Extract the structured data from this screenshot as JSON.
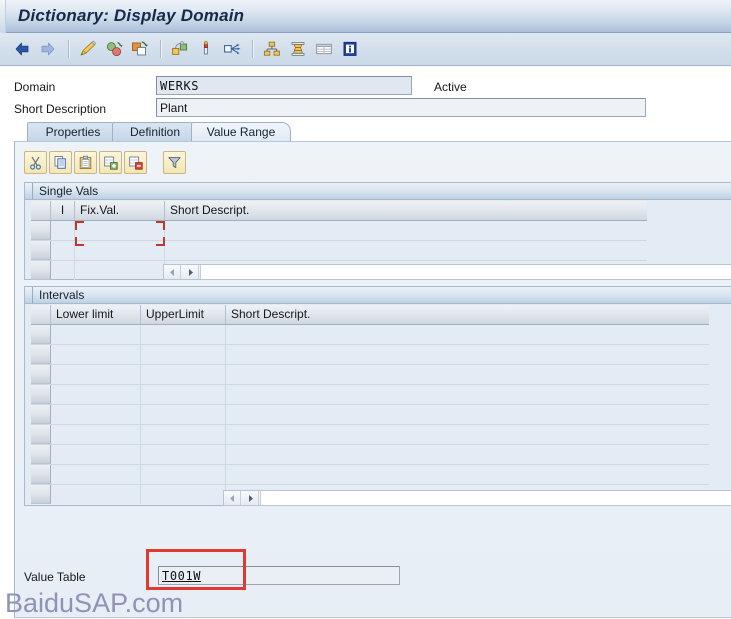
{
  "window": {
    "title": "Dictionary: Display Domain"
  },
  "toolbar": {
    "items": [
      {
        "name": "back-icon",
        "label": "Back"
      },
      {
        "name": "forward-icon",
        "label": "Forward"
      },
      {
        "name": "separator-1",
        "label": ""
      },
      {
        "name": "display-change-icon",
        "label": "Display <-> Change"
      },
      {
        "name": "check-icon",
        "label": "Check"
      },
      {
        "name": "activate-icon",
        "label": "Activate"
      },
      {
        "name": "separator-2",
        "label": ""
      },
      {
        "name": "where-used-icon",
        "label": "Where-Used List"
      },
      {
        "name": "value-range-icon",
        "label": "Value Range"
      },
      {
        "name": "navigate-icon",
        "label": "Navigate"
      },
      {
        "name": "separator-3",
        "label": ""
      },
      {
        "name": "hierarchy-icon",
        "label": "Hierarchy"
      },
      {
        "name": "stack-icon",
        "label": "Stack"
      },
      {
        "name": "table-icon",
        "label": "Table Contents"
      },
      {
        "name": "info-icon",
        "label": "Information"
      }
    ]
  },
  "form": {
    "domain_label": "Domain",
    "domain_value": "WERKS",
    "status": "Active",
    "short_description_label": "Short Description",
    "short_description_value": "Plant"
  },
  "tabs": [
    {
      "label": "Properties",
      "active": false
    },
    {
      "label": "Definition",
      "active": false
    },
    {
      "label": "Value Range",
      "active": true
    }
  ],
  "grid_toolbar": {
    "items": [
      {
        "name": "cut-icon",
        "label": "Cut"
      },
      {
        "name": "copy-icon",
        "label": "Copy"
      },
      {
        "name": "paste-icon",
        "label": "Paste"
      },
      {
        "name": "insert-row-icon",
        "label": "Insert Row"
      },
      {
        "name": "delete-row-icon",
        "label": "Delete Row"
      },
      {
        "name": "filter-icon",
        "label": "Filter"
      }
    ]
  },
  "single_vals": {
    "title": "Single Vals",
    "columns": [
      "",
      "I",
      "Fix.Val.",
      "Short Descript."
    ],
    "rows": [
      {
        "i": "",
        "fix_val": "",
        "short_descript": ""
      },
      {
        "i": "",
        "fix_val": "",
        "short_descript": ""
      },
      {
        "i": "",
        "fix_val": "",
        "short_descript": ""
      }
    ],
    "scroll": {
      "left_arrow": "◄",
      "right_arrow": "►"
    }
  },
  "intervals": {
    "title": "Intervals",
    "columns": [
      "",
      "Lower limit",
      "UpperLimit",
      "Short Descript."
    ],
    "rows": [
      {
        "lower_limit": "",
        "upper_limit": "",
        "short_descript": ""
      },
      {
        "lower_limit": "",
        "upper_limit": "",
        "short_descript": ""
      },
      {
        "lower_limit": "",
        "upper_limit": "",
        "short_descript": ""
      },
      {
        "lower_limit": "",
        "upper_limit": "",
        "short_descript": ""
      },
      {
        "lower_limit": "",
        "upper_limit": "",
        "short_descript": ""
      },
      {
        "lower_limit": "",
        "upper_limit": "",
        "short_descript": ""
      },
      {
        "lower_limit": "",
        "upper_limit": "",
        "short_descript": ""
      },
      {
        "lower_limit": "",
        "upper_limit": "",
        "short_descript": ""
      },
      {
        "lower_limit": "",
        "upper_limit": "",
        "short_descript": ""
      }
    ],
    "scroll": {
      "left_arrow": "◄",
      "right_arrow": "►"
    }
  },
  "value_table": {
    "label": "Value Table",
    "value": "T001W"
  },
  "watermark": "BaiduSAP.com",
  "colors": {
    "title_text": "#162a47",
    "titlebar_top": "#eef3f9",
    "titlebar_bottom": "#a9bfd8",
    "toolbar_bg": "#d2deeb",
    "panel_bg": "#e7eef5",
    "section_header": "#d8e4f0",
    "grid_header": "#e3e8ee",
    "annotation_red": "#e03a2f",
    "cell_cursor_red": "#c0392b",
    "watermark": "#8c94b8",
    "field_bg": "#dfe7f0"
  }
}
